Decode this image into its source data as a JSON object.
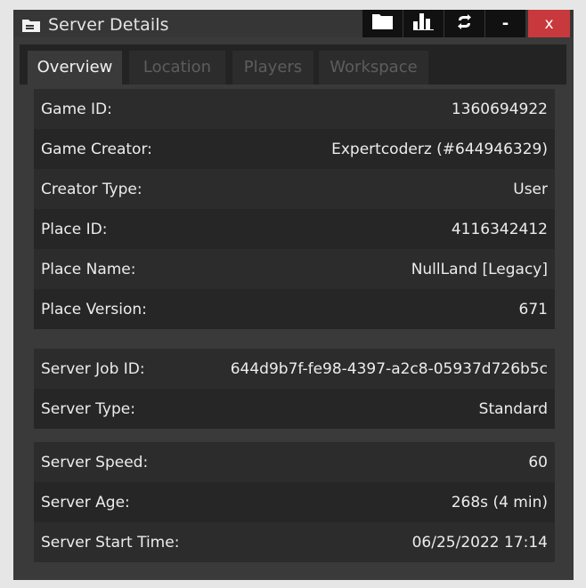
{
  "window": {
    "title": "Server Details",
    "title_icon": "folder-card-icon",
    "toolbar_icons": [
      "folder-icon",
      "bar-chart-icon",
      "refresh-icon"
    ],
    "minimize_label": "-",
    "close_label": "x"
  },
  "tabs": [
    {
      "label": "Overview",
      "active": true
    },
    {
      "label": "Location",
      "active": false
    },
    {
      "label": "Players",
      "active": false
    },
    {
      "label": "Workspace",
      "active": false
    }
  ],
  "overview": {
    "game": [
      {
        "label": "Game ID:",
        "value": "1360694922"
      },
      {
        "label": "Game Creator:",
        "value": "Expertcoderz (#644946329)"
      },
      {
        "label": "Creator Type:",
        "value": "User"
      },
      {
        "label": "Place ID:",
        "value": "4116342412"
      },
      {
        "label": "Place Name:",
        "value": "NullLand [Legacy]"
      },
      {
        "label": "Place Version:",
        "value": "671"
      }
    ],
    "server": [
      {
        "label": "Server Job ID:",
        "value": "644d9b7f-fe98-4397-a2c8-05937d726b5c"
      },
      {
        "label": "Server Type:",
        "value": "Standard"
      }
    ],
    "runtime": [
      {
        "label": "Server Speed:",
        "value": "60"
      },
      {
        "label": "Server Age:",
        "value": "268s (4 min)"
      },
      {
        "label": "Server Start Time:",
        "value": "06/25/2022 17:14"
      }
    ]
  },
  "colors": {
    "close_button": "#c8393d",
    "window_bg": "#3a3a3a",
    "row_dark": "#262626",
    "row_light": "#2c2c2c"
  }
}
